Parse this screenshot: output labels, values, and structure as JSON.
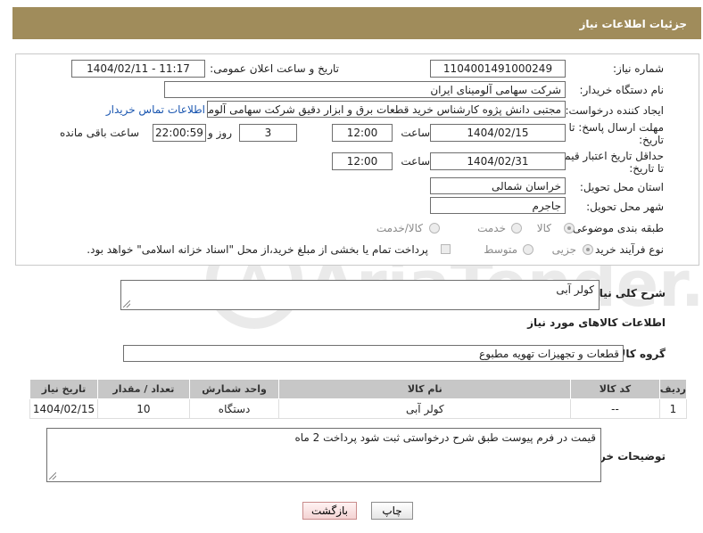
{
  "header": {
    "title": "جزئیات اطلاعات نیاز"
  },
  "form": {
    "need_number_label": "شماره نیاز:",
    "need_number": "1104001491000249",
    "announce_label": "تاریخ و ساعت اعلان عمومی:",
    "announce_value": "1404/02/11 - 11:17",
    "buyer_org_label": "نام دستگاه خریدار:",
    "buyer_org": "شرکت سهامی آلومینای ایران",
    "creator_label": "ایجاد کننده درخواست:",
    "creator": "مجتبی دانش پژوه کارشناس خرید قطعات برق و ابزار دقیق شرکت سهامی آلومینای ایران",
    "contact_link": "اطلاعات تماس خریدار",
    "deadline_label_1": "مهلت ارسال پاسخ: تا",
    "deadline_label_2": "تاریخ:",
    "deadline_date": "1404/02/15",
    "time_label": "ساعت",
    "deadline_time": "12:00",
    "days_value": "3",
    "days_label": "روز و",
    "remaining_time": "22:00:59",
    "remaining_label": "ساعت باقی مانده",
    "validity_label_1": "حداقل تاریخ اعتبار قیمت:",
    "validity_label_2": "تا تاریخ:",
    "validity_date": "1404/02/31",
    "validity_time": "12:00",
    "province_label": "استان محل تحویل:",
    "province": "خراسان شمالی",
    "city_label": "شهر محل تحویل:",
    "city": "جاجرم",
    "category_label": "طبقه بندی موضوعی:",
    "category_options": [
      "کالا",
      "خدمت",
      "کالا/خدمت"
    ],
    "category_selected": 0,
    "process_label": "نوع فرآیند خرید :",
    "process_options": [
      "جزیی",
      "متوسط"
    ],
    "process_selected": 0,
    "payment_note": "پرداخت تمام یا بخشی از مبلغ خرید،از محل \"اسناد خزانه اسلامی\" خواهد بود."
  },
  "summary": {
    "label": "شرح کلی نیاز:",
    "value": "کولر آبی"
  },
  "goods": {
    "section_title": "اطلاعات کالاهای مورد نیاز",
    "group_label": "گروه کالا:",
    "group_value": "قطعات و تجهیزات تهویه مطبوع",
    "columns": [
      "ردیف",
      "کد کالا",
      "نام کالا",
      "واحد شمارش",
      "تعداد / مقدار",
      "تاریخ نیاز"
    ],
    "rows": [
      {
        "row": "1",
        "code": "--",
        "name": "کولر آبی",
        "unit": "دستگاه",
        "qty": "10",
        "date": "1404/02/15"
      }
    ]
  },
  "buyer_notes": {
    "label": "توضیحات خریدار:",
    "value": "قیمت در فرم پیوست  طبق شرح درخواستی ثبت شود پرداخت 2 ماه"
  },
  "buttons": {
    "print": "چاپ",
    "back": "بازگشت"
  },
  "watermark": {
    "text": "AriaTender.neT"
  }
}
